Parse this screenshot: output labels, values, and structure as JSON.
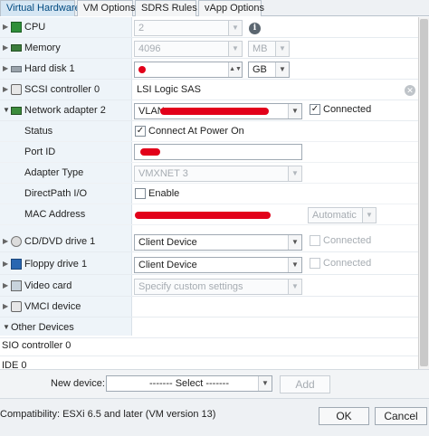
{
  "tabs": [
    "Virtual Hardware",
    "VM Options",
    "SDRS Rules",
    "vApp Options"
  ],
  "cpu": {
    "label": "CPU",
    "value": "2"
  },
  "memory": {
    "label": "Memory",
    "value": "4096",
    "unit": "MB"
  },
  "hard_disk": {
    "label": "Hard disk 1",
    "unit": "GB"
  },
  "scsi": {
    "label": "SCSI controller 0",
    "value": "LSI Logic SAS"
  },
  "network": {
    "label": "Network adapter 2",
    "value": "VLAN",
    "connected_label": "Connected",
    "status_label": "Status",
    "connect_power_label": "Connect At Power On",
    "port_label": "Port ID",
    "adapter_type_label": "Adapter Type",
    "adapter_type_value": "VMXNET 3",
    "directpath_label": "DirectPath I/O",
    "enable_label": "Enable",
    "mac_label": "MAC Address",
    "mac_mode": "Automatic"
  },
  "cddvd": {
    "label": "CD/DVD drive 1",
    "value": "Client Device",
    "connected_label": "Connected"
  },
  "floppy": {
    "label": "Floppy drive 1",
    "value": "Client Device",
    "connected_label": "Connected"
  },
  "video": {
    "label": "Video card",
    "value": "Specify custom settings"
  },
  "vmci": {
    "label": "VMCI device"
  },
  "other": {
    "label": "Other Devices"
  },
  "sio": {
    "label": "SIO controller 0"
  },
  "ide": {
    "label": "IDE 0"
  },
  "new_device": {
    "label": "New device:",
    "select": "------- Select -------",
    "add": "Add"
  },
  "footer": {
    "compatibility": "Compatibility: ESXi 6.5 and later (VM version 13)",
    "ok": "OK",
    "cancel": "Cancel"
  },
  "colors": {
    "accent": "#004a80",
    "redaction": "#e2001a",
    "label_bg": "#eef4f9"
  }
}
